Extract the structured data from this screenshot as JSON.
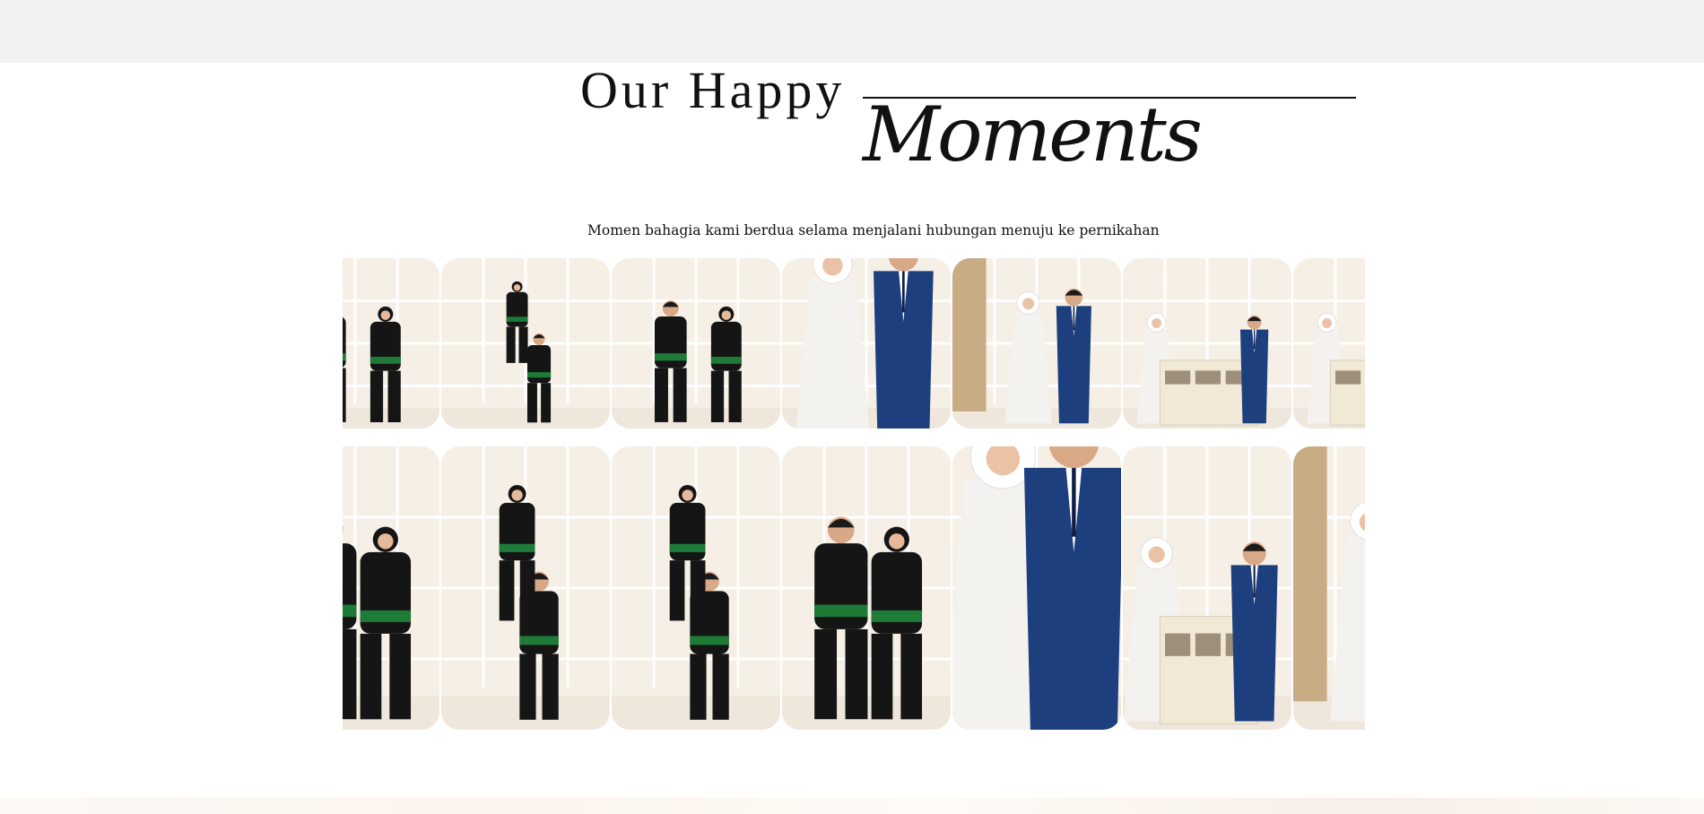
{
  "header": {
    "title_line1": "Our Happy",
    "title_line2": "Moments",
    "subtitle": "Momen bahagia kami berdua selama menjalani hubungan menuju ke pernikahan"
  },
  "colors": {
    "topbar": "#f1f1f1",
    "background": "#ffffff",
    "text": "#111111",
    "uniform_black": "#151515",
    "belt_green": "#1e7a37",
    "suit_blue": "#1d3f7e",
    "gown_white": "#f4f2ef",
    "room_cream": "#f5efe6"
  },
  "gallery": {
    "row1": [
      {
        "name": "silat-pair-standing-cropped-photo",
        "scene": "silat-standing"
      },
      {
        "name": "silat-acrobatic-pose-photo",
        "scene": "silat-acrobatic"
      },
      {
        "name": "silat-pair-standing-photo",
        "scene": "silat-standing"
      },
      {
        "name": "wedding-couple-closeup-photo",
        "scene": "wedding-closeup"
      },
      {
        "name": "wedding-couple-curtain-photo",
        "scene": "wedding-full"
      },
      {
        "name": "wedding-couple-cabinet-photo",
        "scene": "wedding-cabinet"
      },
      {
        "name": "wedding-bride-cropped-photo",
        "scene": "wedding-cabinet"
      }
    ],
    "row2": [
      {
        "name": "silat-bride-cropped-photo",
        "scene": "silat-standing"
      },
      {
        "name": "silat-acrobatic-pose-photo",
        "scene": "silat-acrobatic"
      },
      {
        "name": "silat-acrobatic-pose-alt-photo",
        "scene": "silat-acrobatic"
      },
      {
        "name": "silat-pair-standing-photo",
        "scene": "silat-standing"
      },
      {
        "name": "wedding-couple-closeup-photo",
        "scene": "wedding-closeup"
      },
      {
        "name": "wedding-couple-cabinet-photo",
        "scene": "wedding-cabinet"
      },
      {
        "name": "wedding-bride-curtain-cropped-photo",
        "scene": "wedding-full"
      }
    ]
  }
}
